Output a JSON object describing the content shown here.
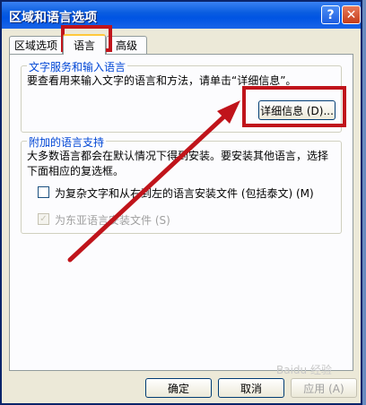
{
  "window": {
    "title": "区域和语言选项",
    "help_icon": "?",
    "close_icon": "✕"
  },
  "tabs": [
    {
      "label": "区域选项"
    },
    {
      "label": "语言"
    },
    {
      "label": "高级"
    }
  ],
  "group1": {
    "legend": "文字服务和输入语言",
    "description": "要查看用来输入文字的语言和方法，请单击“详细信息”。",
    "details_button": "详细信息 (D)..."
  },
  "group2": {
    "legend": "附加的语言支持",
    "description_line1": "大多数语言都会在默认情况下得到安装。要安装其他语言，选择",
    "description_line2": "下面相应的复选框。",
    "checkbox1": {
      "label": "为复杂文字和从右到左的语言安装文件 (包括泰文) (M)",
      "checked": false
    },
    "checkbox2": {
      "label": "为东亚语言安装文件 (S)",
      "checked": true,
      "disabled": true
    }
  },
  "footer": {
    "ok": "确定",
    "cancel": "取消",
    "apply": "应用 (A)"
  },
  "watermark": "Baidu 经验",
  "colors": {
    "highlight": "#c0141b",
    "title_bar": "#0054e3"
  }
}
